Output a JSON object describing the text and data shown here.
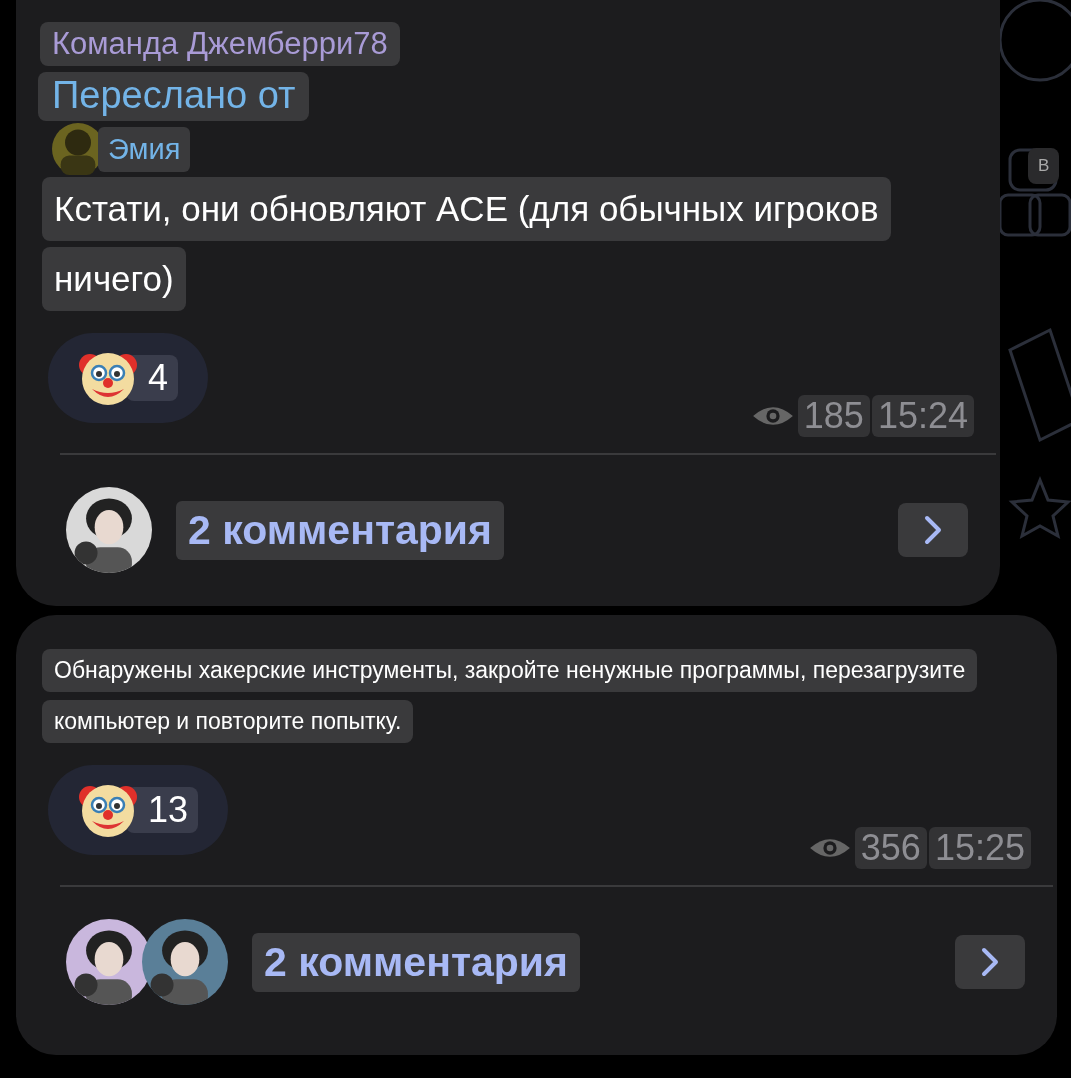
{
  "messages": [
    {
      "kind": "forwarded",
      "channel": "Команда Джемберри78",
      "forwarded_label": "Переслано от",
      "forwarded_from": "Эмия",
      "text_lines": [
        "Кстати, они обновляют ACE (для обычных игроков",
        "ничего)"
      ],
      "reactions": [
        {
          "count": "4"
        }
      ],
      "views": "185",
      "time": "15:24",
      "comments": {
        "label": "2 комментария"
      }
    },
    {
      "kind": "plain",
      "text_lines": [
        "Обнаружены хакерские инструменты, закройте ненужные программы, перезагрузите",
        "компьютер и повторите попытку."
      ],
      "reactions": [
        {
          "count": "13"
        }
      ],
      "views": "356",
      "time": "15:25",
      "comments": {
        "label": "2 комментария"
      }
    }
  ],
  "side_mark": "В"
}
